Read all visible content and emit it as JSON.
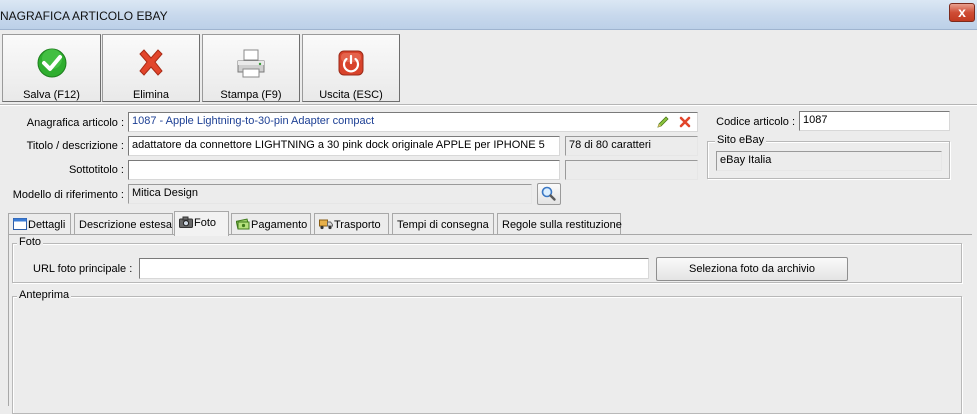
{
  "window": {
    "title": "NAGRAFICA ARTICOLO EBAY",
    "close_label": "x"
  },
  "toolbar": {
    "save_label": "Salva (F12)",
    "delete_label": "Elimina",
    "print_label": "Stampa (F9)",
    "exit_label": "Uscita (ESC)"
  },
  "form": {
    "anagrafica_label": "Anagrafica articolo :",
    "anagrafica_value": "1087 - Apple Lightning-to-30-pin Adapter compact",
    "titolo_label": "Titolo / descrizione :",
    "titolo_value": "adattatore da connettore LIGHTNING a 30 pink dock originale APPLE per IPHONE 5",
    "titolo_count": "78 di 80 caratteri",
    "sottotitolo_label": "Sottotitolo :",
    "sottotitolo_value": "",
    "modello_label": "Modello di riferimento :",
    "modello_value": "Mitica Design",
    "codice_label": "Codice articolo :",
    "codice_value": "1087",
    "sito_title": "Sito eBay",
    "sito_value": "eBay Italia"
  },
  "tabs": [
    {
      "label": "Dettagli",
      "icon": "window-icon"
    },
    {
      "label": "Descrizione estesa",
      "icon": ""
    },
    {
      "label": "Foto",
      "icon": "camera-icon"
    },
    {
      "label": "Pagamento",
      "icon": "money-icon"
    },
    {
      "label": "Trasporto",
      "icon": "truck-icon"
    },
    {
      "label": "Tempi di consegna",
      "icon": ""
    },
    {
      "label": "Regole sulla restituzione",
      "icon": ""
    }
  ],
  "foto": {
    "group_title": "Foto",
    "url_label": "URL foto principale :",
    "url_value": "",
    "select_button": "Seleziona foto da archivio",
    "preview_title": "Anteprima"
  },
  "colors": {
    "save": "#2fae2f",
    "delete": "#e2452b",
    "exit": "#d8432b",
    "link_text": "#1c3f94"
  }
}
